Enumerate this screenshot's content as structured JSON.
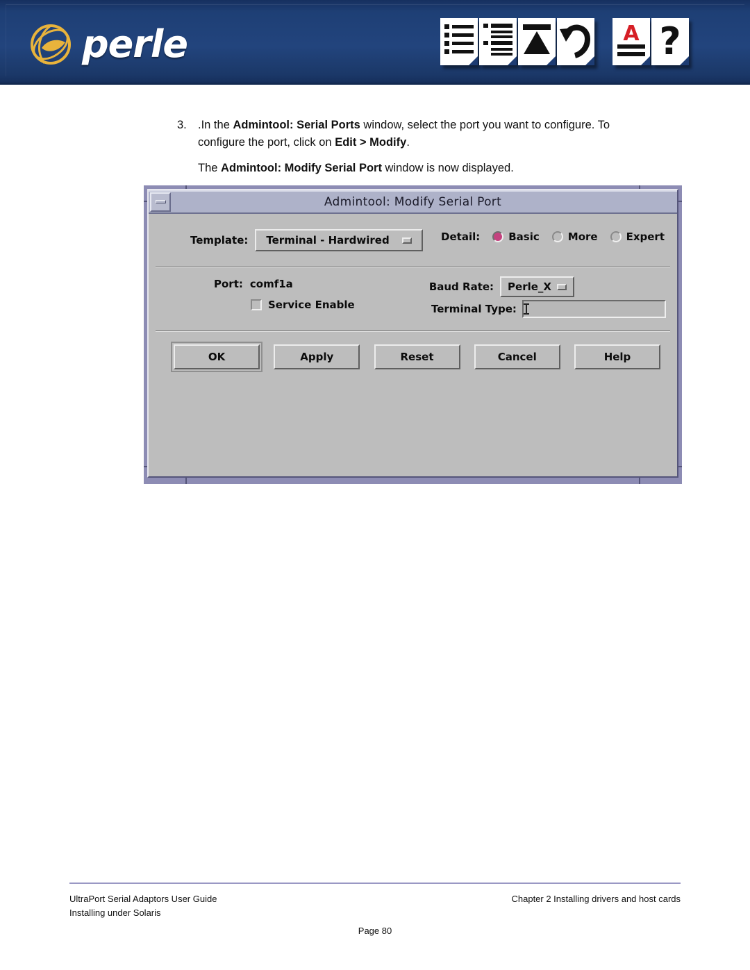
{
  "header": {
    "brand": "perle",
    "logo_color": "#e8b33c",
    "banner_color": "#1c3a6e",
    "icons": [
      {
        "name": "list-document-icon"
      },
      {
        "name": "indented-list-document-icon"
      },
      {
        "name": "triangle-document-icon"
      },
      {
        "name": "undo-arrow-document-icon"
      },
      {
        "name": "letter-a-document-icon"
      },
      {
        "name": "question-mark-document-icon"
      }
    ]
  },
  "step": {
    "number": "3.",
    "line1_pre": ".In the ",
    "line1_bold1": "Admintool: Serial Ports",
    "line1_mid": " window, select the port you want to configure. To configure the port, click on ",
    "line1_bold2": "Edit > Modify",
    "line1_end": ".",
    "line2_pre": "The ",
    "line2_bold": "Admintool: Modify Serial Port",
    "line2_end": " window is now displayed."
  },
  "dialog": {
    "title": "Admintool: Modify Serial Port",
    "minimize_label": "minimize",
    "titlebar_color": "#aeb2c9",
    "body_color": "#bdbdbd",
    "frame_color": "#8d8cb4",
    "accent_color": "#c4427f",
    "template": {
      "label": "Template:",
      "value": "Terminal - Hardwired"
    },
    "detail": {
      "label": "Detail:",
      "options": [
        {
          "label": "Basic",
          "selected": true
        },
        {
          "label": "More",
          "selected": false
        },
        {
          "label": "Expert",
          "selected": false
        }
      ]
    },
    "port": {
      "label": "Port:",
      "value": "comf1a"
    },
    "service_enable": {
      "label": "Service Enable",
      "checked": false
    },
    "baud_rate": {
      "label": "Baud Rate:",
      "value": "Perle_X"
    },
    "terminal_type": {
      "label": "Terminal Type:",
      "value": "",
      "placeholder": ""
    },
    "buttons": [
      {
        "label": "OK",
        "default": true
      },
      {
        "label": "Apply",
        "default": false
      },
      {
        "label": "Reset",
        "default": false
      },
      {
        "label": "Cancel",
        "default": false
      },
      {
        "label": "Help",
        "default": false
      }
    ]
  },
  "footer": {
    "left_line1": "UltraPort Serial Adaptors User Guide",
    "left_line2": "Installing under Solaris",
    "right_line1": "Chapter 2 Installing drivers and host cards",
    "page": "Page 80",
    "rule_color": "#9a98c4"
  }
}
